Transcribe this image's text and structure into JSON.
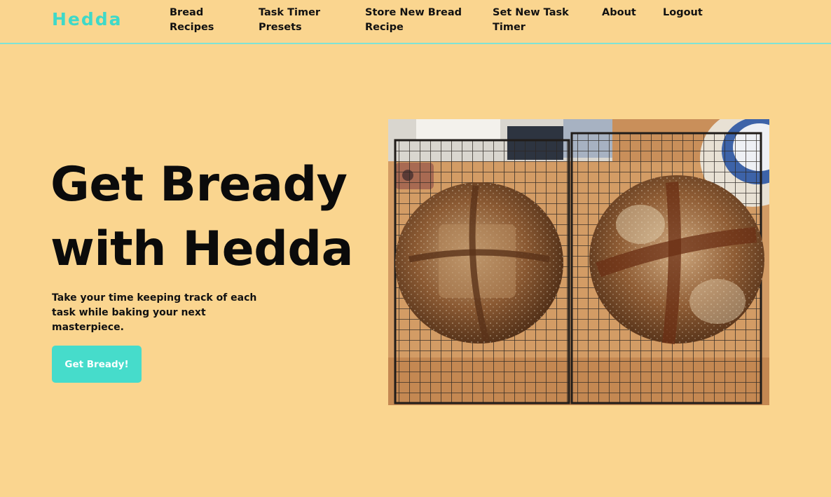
{
  "brand": {
    "name": "Hedda",
    "color": "#3FD9C8"
  },
  "nav": {
    "links": [
      {
        "label": "Bread Recipes"
      },
      {
        "label": "Task Timer Presets"
      },
      {
        "label": "Store New Bread Recipe"
      },
      {
        "label": "Set New Task Timer"
      },
      {
        "label": "About"
      },
      {
        "label": "Logout"
      }
    ]
  },
  "hero": {
    "title": "Get Bready with Hedda",
    "subtitle": "Take your time keeping track of each task while baking your next masterpiece.",
    "cta_label": "Get Bready!",
    "cta_color": "#46DCCB",
    "image_subject": "two sourdough loaves on wire cooling racks"
  },
  "colors": {
    "background": "#FAD58F",
    "nav_border": "#7FE3D6"
  }
}
